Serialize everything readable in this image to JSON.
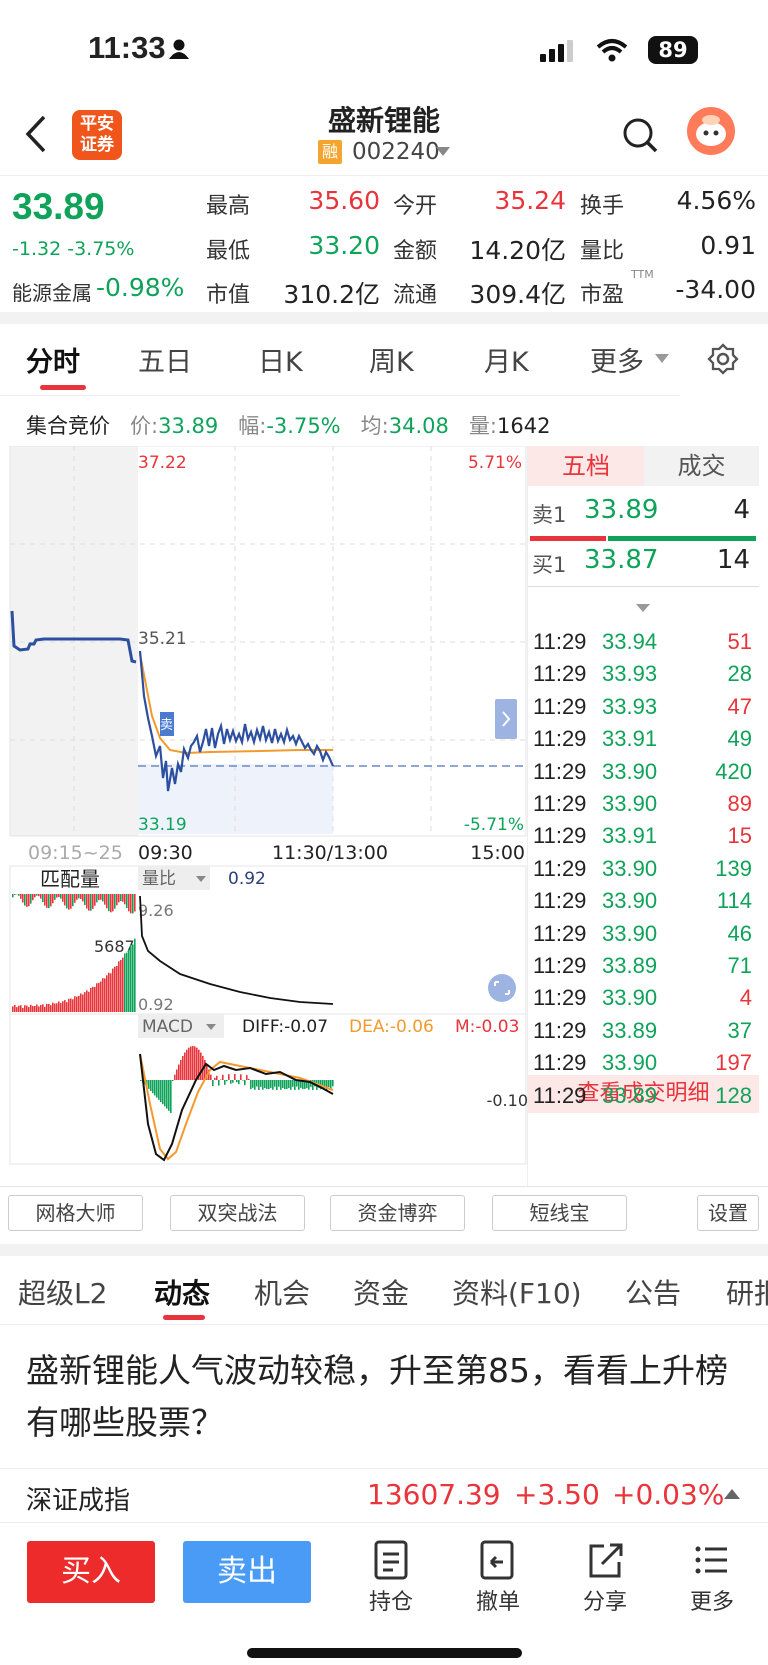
{
  "status_bar": {
    "time": "11:33",
    "battery": "89"
  },
  "header": {
    "stock_name": "盛新锂能",
    "margin_tag": "融",
    "stock_code": "002240",
    "broker_logo_line1": "平安",
    "broker_logo_line2": "证券"
  },
  "quote": {
    "price": "33.89",
    "change": "-1.32",
    "change_pct": "-3.75%",
    "sector_label": "能源金属",
    "sector_change": "-0.98%",
    "high_label": "最高",
    "high": "35.60",
    "open_label": "今开",
    "open": "35.24",
    "turnover_label": "换手",
    "turnover": "4.56%",
    "low_label": "最低",
    "low": "33.20",
    "amount_label": "金额",
    "amount": "14.20亿",
    "vol_ratio_label": "量比",
    "vol_ratio": "0.91",
    "mktcap_label": "市值",
    "mktcap": "310.2亿",
    "float_label": "流通",
    "float_cap": "309.4亿",
    "pe_label": "市盈",
    "pe_sup": "TTM",
    "pe": "-34.00"
  },
  "chart_tabs": [
    "分时",
    "五日",
    "日K",
    "周K",
    "月K",
    "更多"
  ],
  "auction_bar": {
    "label": "集合竞价",
    "price_label": "价:",
    "price": "33.89",
    "pct_label": "幅:",
    "pct": "-3.75%",
    "avg_label": "均:",
    "avg": "34.08",
    "vol_label": "量:",
    "vol": "1642"
  },
  "chart": {
    "top_price": "37.22",
    "top_pct": "5.71%",
    "mid_price": "35.21",
    "bottom_price": "33.19",
    "bottom_pct": "-5.71%",
    "sell_marker": "卖",
    "time_labels": [
      "09:15~25",
      "09:30",
      "11:30/13:00",
      "15:00"
    ]
  },
  "volume_panel": {
    "label": "匹配量",
    "selector": "量比",
    "value": "0.92",
    "top_value": "9.26",
    "left_value": "5687",
    "bottom_value": "0.92"
  },
  "macd_panel": {
    "selector": "MACD",
    "diff": "DIFF:-0.07",
    "dea": "DEA:-0.06",
    "m": "M:-0.03",
    "axis_value": "-0.10"
  },
  "order_book": {
    "tab_active": "五档",
    "tab_other": "成交",
    "sell1": {
      "label": "卖1",
      "price": "33.89",
      "vol": "4"
    },
    "buy1": {
      "label": "买1",
      "price": "33.87",
      "vol": "14"
    },
    "trades": [
      {
        "t": "11:29",
        "p": "33.94",
        "v": "51",
        "c": "red"
      },
      {
        "t": "11:29",
        "p": "33.93",
        "v": "28",
        "c": "green"
      },
      {
        "t": "11:29",
        "p": "33.93",
        "v": "47",
        "c": "red"
      },
      {
        "t": "11:29",
        "p": "33.91",
        "v": "49",
        "c": "green"
      },
      {
        "t": "11:29",
        "p": "33.90",
        "v": "420",
        "c": "green"
      },
      {
        "t": "11:29",
        "p": "33.90",
        "v": "89",
        "c": "red"
      },
      {
        "t": "11:29",
        "p": "33.91",
        "v": "15",
        "c": "red"
      },
      {
        "t": "11:29",
        "p": "33.90",
        "v": "139",
        "c": "green"
      },
      {
        "t": "11:29",
        "p": "33.90",
        "v": "114",
        "c": "green"
      },
      {
        "t": "11:29",
        "p": "33.90",
        "v": "46",
        "c": "green"
      },
      {
        "t": "11:29",
        "p": "33.89",
        "v": "71",
        "c": "green"
      },
      {
        "t": "11:29",
        "p": "33.90",
        "v": "4",
        "c": "red"
      },
      {
        "t": "11:29",
        "p": "33.89",
        "v": "37",
        "c": "green"
      },
      {
        "t": "11:29",
        "p": "33.90",
        "v": "197",
        "c": "red"
      },
      {
        "t": "11:29",
        "p": "33.89",
        "v": "128",
        "c": "green"
      }
    ],
    "detail_link": "查看成交明细"
  },
  "tools": [
    "网格大师",
    "双突战法",
    "资金博弈",
    "短线宝",
    "设置"
  ],
  "news_tabs": [
    "超级L2",
    "动态",
    "机会",
    "资金",
    "资料(F10)",
    "公告",
    "研报"
  ],
  "news_headline": "盛新锂能人气波动较稳，升至第85，看看上升榜有哪些股票？",
  "index_ticker": {
    "name": "深证成指",
    "value": "13607.39",
    "change": "+3.50",
    "pct": "+0.03%"
  },
  "bottom_bar": {
    "buy": "买入",
    "sell": "卖出",
    "items": [
      "持仓",
      "撤单",
      "分享",
      "更多"
    ]
  },
  "colors": {
    "up": "#e8343a",
    "down": "#0fa35a",
    "buy_btn": "#ee2b2b",
    "sell_btn": "#4a9bf6",
    "price_line": "#2c4fa0",
    "avg_line": "#f29a2e"
  }
}
